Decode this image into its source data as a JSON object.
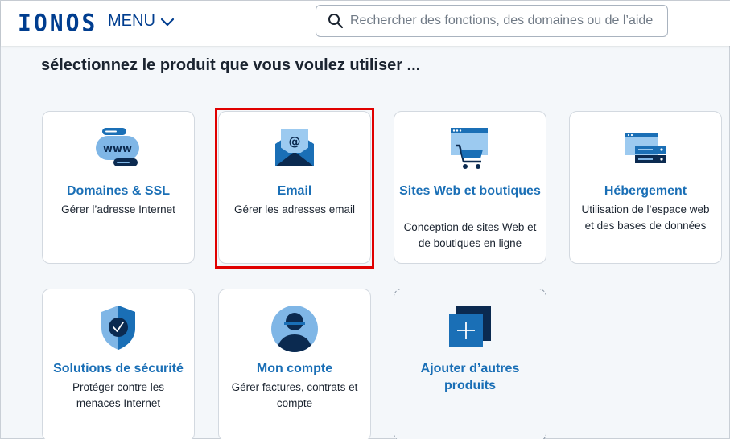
{
  "header": {
    "logo": "IONOS",
    "menu_label": "MENU",
    "search_placeholder": "Rechercher des fonctions, des domaines ou de l’aide"
  },
  "page": {
    "title": "sélectionnez le produit que vous voulez utiliser ..."
  },
  "products": [
    {
      "name": "Domaines & SSL",
      "desc": "Gérer l’adresse Internet",
      "icon": "www-domain-icon"
    },
    {
      "name": "Email",
      "desc": "Gérer les adresses email",
      "icon": "email-envelope-icon",
      "highlighted": true
    },
    {
      "name": "Sites Web et boutiques",
      "desc": "Conception de sites Web et de boutiques en ligne",
      "icon": "website-shop-cart-icon"
    },
    {
      "name": "Hébergement",
      "desc": "Utilisation de l’espace web et des bases de données",
      "icon": "hosting-server-icon"
    },
    {
      "name": "Solutions de sécurité",
      "desc": "Protéger contre les menaces Internet",
      "icon": "security-shield-icon"
    },
    {
      "name": "Mon compte",
      "desc": "Gérer factures, contrats et compte",
      "icon": "account-user-icon"
    },
    {
      "name": "Ajouter d’autres produits",
      "desc": "",
      "icon": "add-plus-icon"
    }
  ],
  "colors": {
    "brand": "#003d8f",
    "link": "#1a6fb6",
    "highlight": "#e00000",
    "background": "#f4f7fa"
  }
}
